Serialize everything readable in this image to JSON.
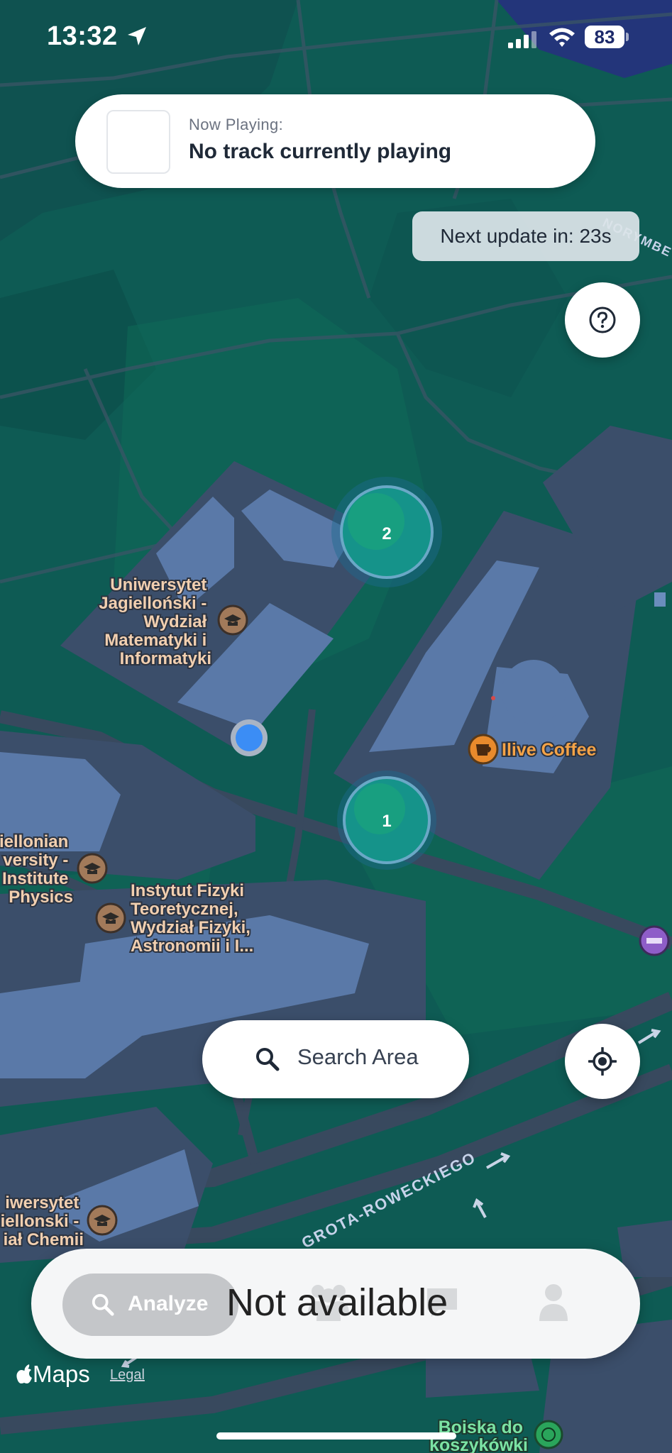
{
  "status_bar": {
    "time": "13:32",
    "battery": "83"
  },
  "now_playing": {
    "label": "Now Playing:",
    "title": "No track currently playing"
  },
  "update_pill": {
    "text": "Next update in: 23s"
  },
  "map": {
    "clusters": [
      {
        "count": "2"
      },
      {
        "count": "1"
      }
    ],
    "places": {
      "math": [
        "Uniwersytet",
        "Jagielloński -",
        "Wydział",
        "Matematyki i",
        "Informatyki"
      ],
      "coffee": "Ilive Coffee",
      "physics_left": [
        "iellonian",
        "versity -",
        "Institute",
        "Physics"
      ],
      "theory": [
        "Instytut Fizyki",
        "Teoretycznej,",
        "Wydział Fizyki,",
        "Astronomii i I..."
      ],
      "chem": [
        "iwersytet",
        "iellonski -",
        "iał Chemii"
      ],
      "boiska": [
        "Boiska do",
        "koszykówki"
      ]
    },
    "roads": {
      "upper_right": "NORYMBE",
      "lower": "GROTA-ROWECKIEGO"
    }
  },
  "search_area": {
    "label": "Search Area"
  },
  "tabbar": {
    "analyze_label": "Analyze",
    "overlay_text": "Not available"
  },
  "footer": {
    "maps": "Maps",
    "legal": "Legal"
  }
}
